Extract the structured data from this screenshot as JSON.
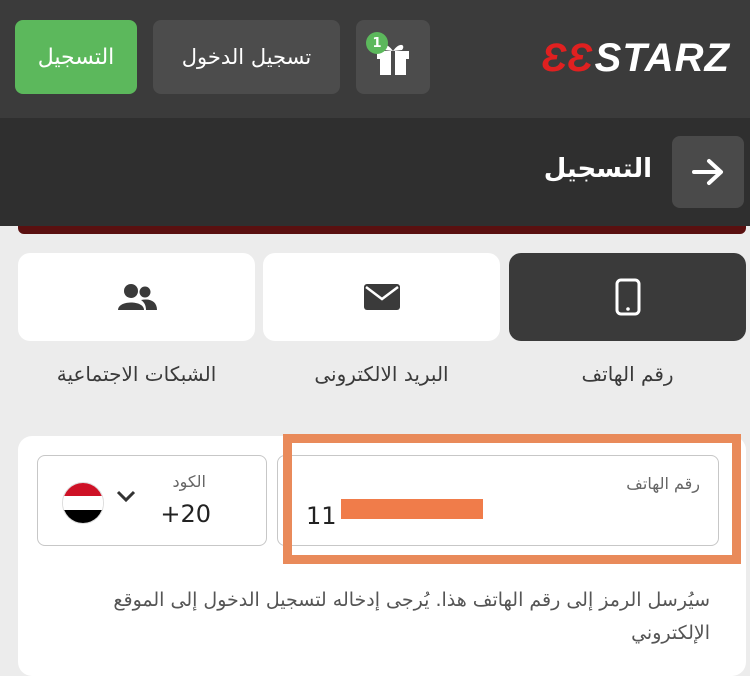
{
  "header": {
    "register_label": "التسجيل",
    "login_label": "تسجيل الدخول",
    "gift_badge": "1",
    "logo_mark": "ƐƐ",
    "logo_text": "STARZ"
  },
  "subheader": {
    "title": "التسجيل",
    "back_icon": "arrow-right-icon"
  },
  "tabs": [
    {
      "label": "رقم الهاتف",
      "icon": "mobile-phone-icon",
      "active": true
    },
    {
      "label": "البريد الالكترونى",
      "icon": "envelope-icon",
      "active": false
    },
    {
      "label": "الشبكات الاجتماعية",
      "icon": "users-icon",
      "active": false
    }
  ],
  "form": {
    "code_label": "الكود",
    "code_value": "+20",
    "country_flag": "egypt-flag",
    "phone_label": "رقم الهاتف",
    "phone_value": "11",
    "hint": "سيُرسل الرمز إلى رقم الهاتف هذا. يُرجى إدخاله لتسجيل الدخول إلى الموقع الإلكتروني"
  },
  "colors": {
    "accent_green": "#5cb85c",
    "header_bg": "#3b3b3b",
    "highlight": "#e98a5a"
  }
}
